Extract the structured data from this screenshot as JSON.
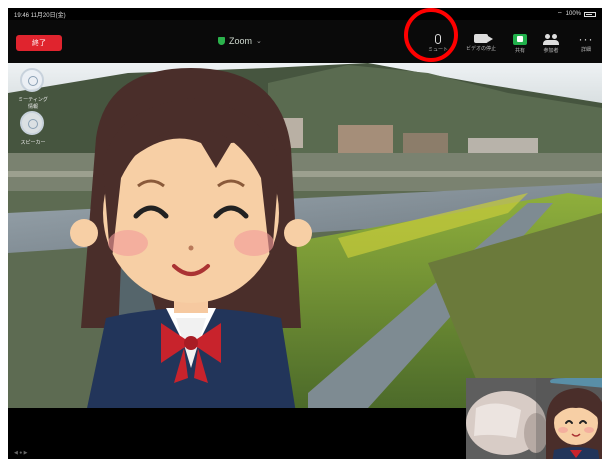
{
  "status_bar": {
    "time": "19:46",
    "date": "11月20日(金)",
    "battery": "100%"
  },
  "top_bar": {
    "leave_label": "終了",
    "meeting_title": "Zoom",
    "tools": [
      {
        "icon": "microphone-icon",
        "label": "ミュート"
      },
      {
        "icon": "video-camera-icon",
        "label": "ビデオの停止"
      },
      {
        "icon": "share-screen-icon",
        "label": "共有"
      },
      {
        "icon": "participants-icon",
        "label": "参加者"
      },
      {
        "icon": "more-icon",
        "label": "詳細"
      }
    ]
  },
  "side_buttons": [
    {
      "label": "ミーティング情報"
    },
    {
      "label": "スピーカー"
    }
  ],
  "highlight_color": "#ff0000",
  "brand_colors": {
    "leave": "#e0242e",
    "share": "#21b14b"
  }
}
